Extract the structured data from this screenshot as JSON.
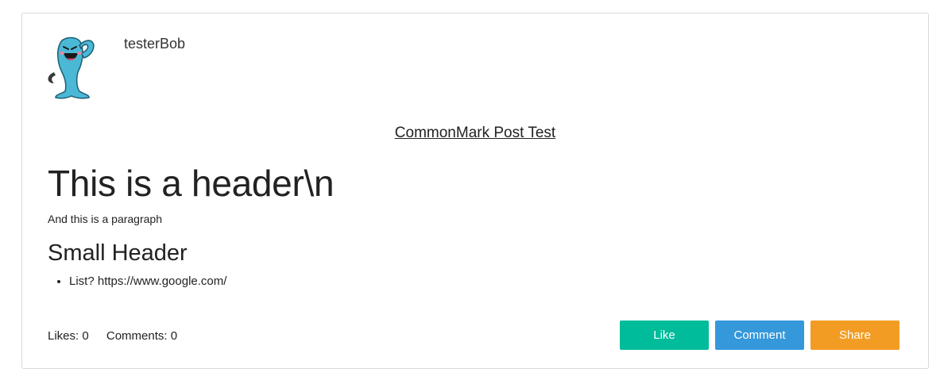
{
  "post": {
    "author": "testerBob",
    "avatar_icon": "blue-cartoon-character-avatar",
    "title": "CommonMark Post Test",
    "body": {
      "header": "This is a header\\n",
      "paragraph": "And this is a paragraph",
      "subheader": "Small Header",
      "list_items": [
        "List? https://www.google.com/"
      ]
    },
    "stats": {
      "likes": "Likes: 0",
      "comments": "Comments: 0"
    },
    "actions": {
      "like_label": "Like",
      "comment_label": "Comment",
      "share_label": "Share"
    }
  },
  "colors": {
    "like": "#00bc9b",
    "comment": "#3498db",
    "share": "#f39c24"
  }
}
